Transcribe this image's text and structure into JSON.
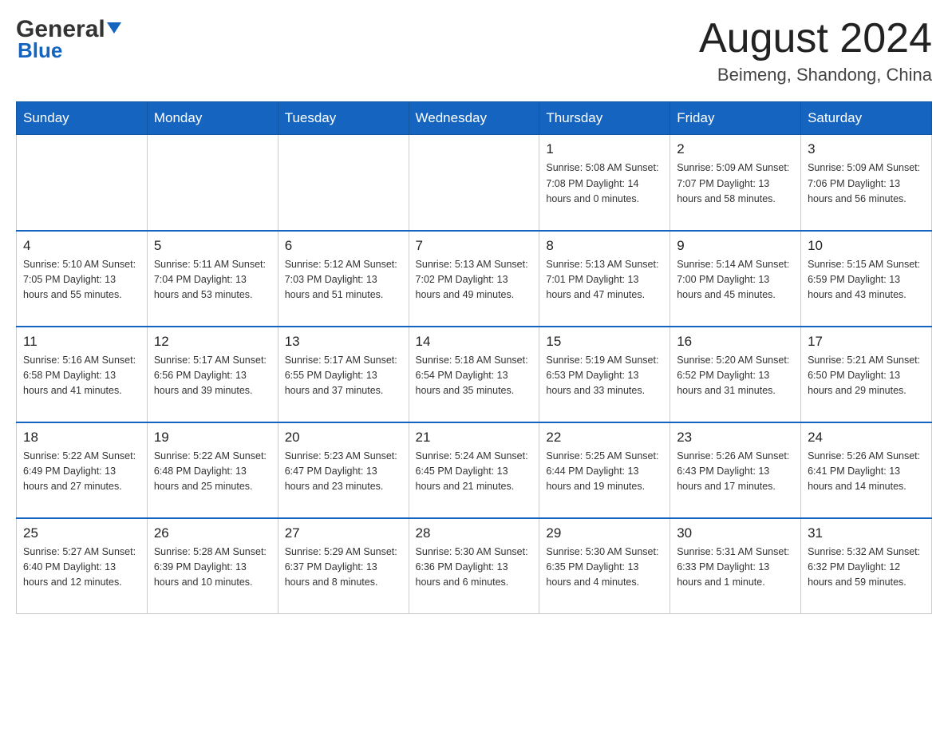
{
  "header": {
    "logo_general": "General",
    "logo_blue": "Blue",
    "month": "August 2024",
    "location": "Beimeng, Shandong, China"
  },
  "weekdays": [
    "Sunday",
    "Monday",
    "Tuesday",
    "Wednesday",
    "Thursday",
    "Friday",
    "Saturday"
  ],
  "weeks": [
    [
      {
        "day": "",
        "info": ""
      },
      {
        "day": "",
        "info": ""
      },
      {
        "day": "",
        "info": ""
      },
      {
        "day": "",
        "info": ""
      },
      {
        "day": "1",
        "info": "Sunrise: 5:08 AM\nSunset: 7:08 PM\nDaylight: 14 hours\nand 0 minutes."
      },
      {
        "day": "2",
        "info": "Sunrise: 5:09 AM\nSunset: 7:07 PM\nDaylight: 13 hours\nand 58 minutes."
      },
      {
        "day": "3",
        "info": "Sunrise: 5:09 AM\nSunset: 7:06 PM\nDaylight: 13 hours\nand 56 minutes."
      }
    ],
    [
      {
        "day": "4",
        "info": "Sunrise: 5:10 AM\nSunset: 7:05 PM\nDaylight: 13 hours\nand 55 minutes."
      },
      {
        "day": "5",
        "info": "Sunrise: 5:11 AM\nSunset: 7:04 PM\nDaylight: 13 hours\nand 53 minutes."
      },
      {
        "day": "6",
        "info": "Sunrise: 5:12 AM\nSunset: 7:03 PM\nDaylight: 13 hours\nand 51 minutes."
      },
      {
        "day": "7",
        "info": "Sunrise: 5:13 AM\nSunset: 7:02 PM\nDaylight: 13 hours\nand 49 minutes."
      },
      {
        "day": "8",
        "info": "Sunrise: 5:13 AM\nSunset: 7:01 PM\nDaylight: 13 hours\nand 47 minutes."
      },
      {
        "day": "9",
        "info": "Sunrise: 5:14 AM\nSunset: 7:00 PM\nDaylight: 13 hours\nand 45 minutes."
      },
      {
        "day": "10",
        "info": "Sunrise: 5:15 AM\nSunset: 6:59 PM\nDaylight: 13 hours\nand 43 minutes."
      }
    ],
    [
      {
        "day": "11",
        "info": "Sunrise: 5:16 AM\nSunset: 6:58 PM\nDaylight: 13 hours\nand 41 minutes."
      },
      {
        "day": "12",
        "info": "Sunrise: 5:17 AM\nSunset: 6:56 PM\nDaylight: 13 hours\nand 39 minutes."
      },
      {
        "day": "13",
        "info": "Sunrise: 5:17 AM\nSunset: 6:55 PM\nDaylight: 13 hours\nand 37 minutes."
      },
      {
        "day": "14",
        "info": "Sunrise: 5:18 AM\nSunset: 6:54 PM\nDaylight: 13 hours\nand 35 minutes."
      },
      {
        "day": "15",
        "info": "Sunrise: 5:19 AM\nSunset: 6:53 PM\nDaylight: 13 hours\nand 33 minutes."
      },
      {
        "day": "16",
        "info": "Sunrise: 5:20 AM\nSunset: 6:52 PM\nDaylight: 13 hours\nand 31 minutes."
      },
      {
        "day": "17",
        "info": "Sunrise: 5:21 AM\nSunset: 6:50 PM\nDaylight: 13 hours\nand 29 minutes."
      }
    ],
    [
      {
        "day": "18",
        "info": "Sunrise: 5:22 AM\nSunset: 6:49 PM\nDaylight: 13 hours\nand 27 minutes."
      },
      {
        "day": "19",
        "info": "Sunrise: 5:22 AM\nSunset: 6:48 PM\nDaylight: 13 hours\nand 25 minutes."
      },
      {
        "day": "20",
        "info": "Sunrise: 5:23 AM\nSunset: 6:47 PM\nDaylight: 13 hours\nand 23 minutes."
      },
      {
        "day": "21",
        "info": "Sunrise: 5:24 AM\nSunset: 6:45 PM\nDaylight: 13 hours\nand 21 minutes."
      },
      {
        "day": "22",
        "info": "Sunrise: 5:25 AM\nSunset: 6:44 PM\nDaylight: 13 hours\nand 19 minutes."
      },
      {
        "day": "23",
        "info": "Sunrise: 5:26 AM\nSunset: 6:43 PM\nDaylight: 13 hours\nand 17 minutes."
      },
      {
        "day": "24",
        "info": "Sunrise: 5:26 AM\nSunset: 6:41 PM\nDaylight: 13 hours\nand 14 minutes."
      }
    ],
    [
      {
        "day": "25",
        "info": "Sunrise: 5:27 AM\nSunset: 6:40 PM\nDaylight: 13 hours\nand 12 minutes."
      },
      {
        "day": "26",
        "info": "Sunrise: 5:28 AM\nSunset: 6:39 PM\nDaylight: 13 hours\nand 10 minutes."
      },
      {
        "day": "27",
        "info": "Sunrise: 5:29 AM\nSunset: 6:37 PM\nDaylight: 13 hours\nand 8 minutes."
      },
      {
        "day": "28",
        "info": "Sunrise: 5:30 AM\nSunset: 6:36 PM\nDaylight: 13 hours\nand 6 minutes."
      },
      {
        "day": "29",
        "info": "Sunrise: 5:30 AM\nSunset: 6:35 PM\nDaylight: 13 hours\nand 4 minutes."
      },
      {
        "day": "30",
        "info": "Sunrise: 5:31 AM\nSunset: 6:33 PM\nDaylight: 13 hours\nand 1 minute."
      },
      {
        "day": "31",
        "info": "Sunrise: 5:32 AM\nSunset: 6:32 PM\nDaylight: 12 hours\nand 59 minutes."
      }
    ]
  ]
}
